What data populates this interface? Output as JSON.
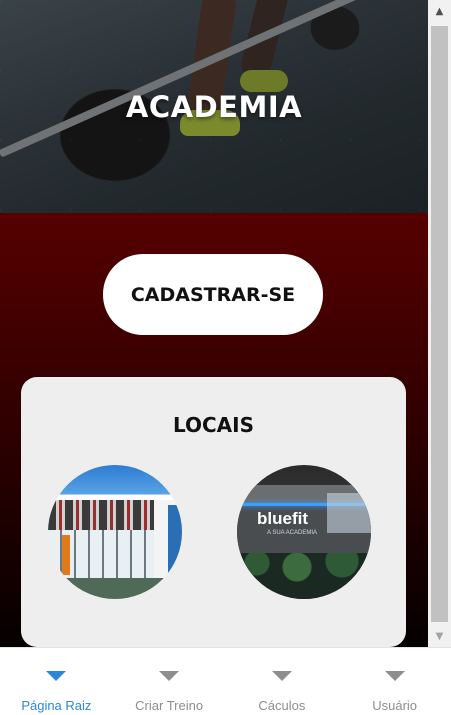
{
  "hero": {
    "title": "ACADEMIA"
  },
  "cta": {
    "label": "CADASTRAR-SE"
  },
  "locations_card": {
    "title": "LOCAIS",
    "locations": [
      {
        "icon": "gym-building-photo"
      },
      {
        "icon": "bluefit-gym-photo",
        "sign_text": "bluefit",
        "sign_subtext": "A SUA ACADEMIA"
      }
    ]
  },
  "tabbar": {
    "active_color": "#2f86d6",
    "inactive_color": "#8e8e8e",
    "tabs": [
      {
        "label": "Página Raiz",
        "icon": "triangle-down-icon",
        "active": true
      },
      {
        "label": "Criar Treino",
        "icon": "triangle-down-icon",
        "active": false
      },
      {
        "label": "Cáculos",
        "icon": "triangle-down-icon",
        "active": false
      },
      {
        "label": "Usuário",
        "icon": "triangle-down-icon",
        "active": false
      }
    ]
  },
  "scrollbar": {
    "up_icon": "▲",
    "down_icon": "▼"
  }
}
